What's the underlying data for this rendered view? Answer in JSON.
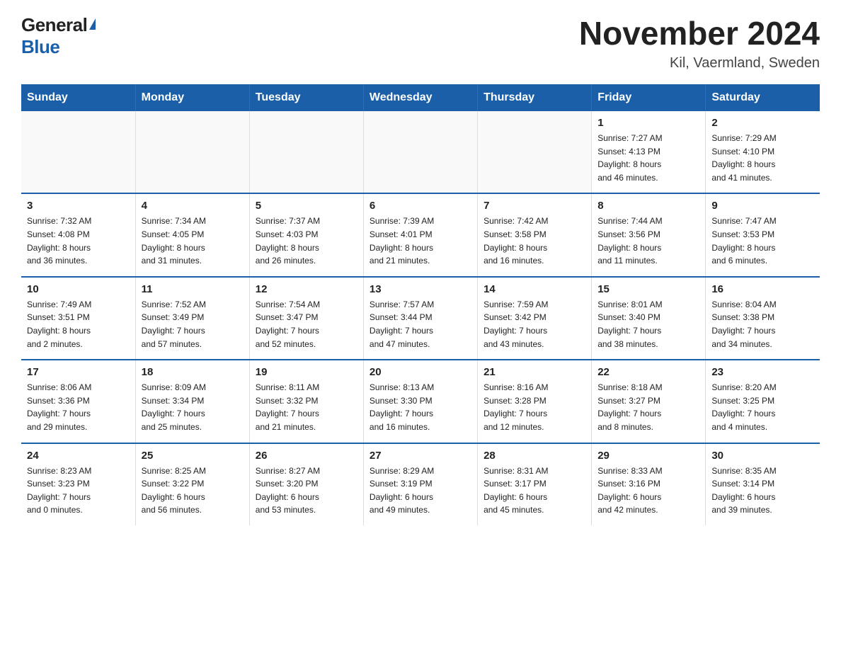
{
  "header": {
    "logo_general": "General",
    "logo_blue": "Blue",
    "month_title": "November 2024",
    "location": "Kil, Vaermland, Sweden"
  },
  "days_of_week": [
    "Sunday",
    "Monday",
    "Tuesday",
    "Wednesday",
    "Thursday",
    "Friday",
    "Saturday"
  ],
  "weeks": [
    {
      "days": [
        {
          "num": "",
          "info": "",
          "empty": true
        },
        {
          "num": "",
          "info": "",
          "empty": true
        },
        {
          "num": "",
          "info": "",
          "empty": true
        },
        {
          "num": "",
          "info": "",
          "empty": true
        },
        {
          "num": "",
          "info": "",
          "empty": true
        },
        {
          "num": "1",
          "info": "Sunrise: 7:27 AM\nSunset: 4:13 PM\nDaylight: 8 hours\nand 46 minutes.",
          "empty": false
        },
        {
          "num": "2",
          "info": "Sunrise: 7:29 AM\nSunset: 4:10 PM\nDaylight: 8 hours\nand 41 minutes.",
          "empty": false
        }
      ]
    },
    {
      "days": [
        {
          "num": "3",
          "info": "Sunrise: 7:32 AM\nSunset: 4:08 PM\nDaylight: 8 hours\nand 36 minutes.",
          "empty": false
        },
        {
          "num": "4",
          "info": "Sunrise: 7:34 AM\nSunset: 4:05 PM\nDaylight: 8 hours\nand 31 minutes.",
          "empty": false
        },
        {
          "num": "5",
          "info": "Sunrise: 7:37 AM\nSunset: 4:03 PM\nDaylight: 8 hours\nand 26 minutes.",
          "empty": false
        },
        {
          "num": "6",
          "info": "Sunrise: 7:39 AM\nSunset: 4:01 PM\nDaylight: 8 hours\nand 21 minutes.",
          "empty": false
        },
        {
          "num": "7",
          "info": "Sunrise: 7:42 AM\nSunset: 3:58 PM\nDaylight: 8 hours\nand 16 minutes.",
          "empty": false
        },
        {
          "num": "8",
          "info": "Sunrise: 7:44 AM\nSunset: 3:56 PM\nDaylight: 8 hours\nand 11 minutes.",
          "empty": false
        },
        {
          "num": "9",
          "info": "Sunrise: 7:47 AM\nSunset: 3:53 PM\nDaylight: 8 hours\nand 6 minutes.",
          "empty": false
        }
      ]
    },
    {
      "days": [
        {
          "num": "10",
          "info": "Sunrise: 7:49 AM\nSunset: 3:51 PM\nDaylight: 8 hours\nand 2 minutes.",
          "empty": false
        },
        {
          "num": "11",
          "info": "Sunrise: 7:52 AM\nSunset: 3:49 PM\nDaylight: 7 hours\nand 57 minutes.",
          "empty": false
        },
        {
          "num": "12",
          "info": "Sunrise: 7:54 AM\nSunset: 3:47 PM\nDaylight: 7 hours\nand 52 minutes.",
          "empty": false
        },
        {
          "num": "13",
          "info": "Sunrise: 7:57 AM\nSunset: 3:44 PM\nDaylight: 7 hours\nand 47 minutes.",
          "empty": false
        },
        {
          "num": "14",
          "info": "Sunrise: 7:59 AM\nSunset: 3:42 PM\nDaylight: 7 hours\nand 43 minutes.",
          "empty": false
        },
        {
          "num": "15",
          "info": "Sunrise: 8:01 AM\nSunset: 3:40 PM\nDaylight: 7 hours\nand 38 minutes.",
          "empty": false
        },
        {
          "num": "16",
          "info": "Sunrise: 8:04 AM\nSunset: 3:38 PM\nDaylight: 7 hours\nand 34 minutes.",
          "empty": false
        }
      ]
    },
    {
      "days": [
        {
          "num": "17",
          "info": "Sunrise: 8:06 AM\nSunset: 3:36 PM\nDaylight: 7 hours\nand 29 minutes.",
          "empty": false
        },
        {
          "num": "18",
          "info": "Sunrise: 8:09 AM\nSunset: 3:34 PM\nDaylight: 7 hours\nand 25 minutes.",
          "empty": false
        },
        {
          "num": "19",
          "info": "Sunrise: 8:11 AM\nSunset: 3:32 PM\nDaylight: 7 hours\nand 21 minutes.",
          "empty": false
        },
        {
          "num": "20",
          "info": "Sunrise: 8:13 AM\nSunset: 3:30 PM\nDaylight: 7 hours\nand 16 minutes.",
          "empty": false
        },
        {
          "num": "21",
          "info": "Sunrise: 8:16 AM\nSunset: 3:28 PM\nDaylight: 7 hours\nand 12 minutes.",
          "empty": false
        },
        {
          "num": "22",
          "info": "Sunrise: 8:18 AM\nSunset: 3:27 PM\nDaylight: 7 hours\nand 8 minutes.",
          "empty": false
        },
        {
          "num": "23",
          "info": "Sunrise: 8:20 AM\nSunset: 3:25 PM\nDaylight: 7 hours\nand 4 minutes.",
          "empty": false
        }
      ]
    },
    {
      "days": [
        {
          "num": "24",
          "info": "Sunrise: 8:23 AM\nSunset: 3:23 PM\nDaylight: 7 hours\nand 0 minutes.",
          "empty": false
        },
        {
          "num": "25",
          "info": "Sunrise: 8:25 AM\nSunset: 3:22 PM\nDaylight: 6 hours\nand 56 minutes.",
          "empty": false
        },
        {
          "num": "26",
          "info": "Sunrise: 8:27 AM\nSunset: 3:20 PM\nDaylight: 6 hours\nand 53 minutes.",
          "empty": false
        },
        {
          "num": "27",
          "info": "Sunrise: 8:29 AM\nSunset: 3:19 PM\nDaylight: 6 hours\nand 49 minutes.",
          "empty": false
        },
        {
          "num": "28",
          "info": "Sunrise: 8:31 AM\nSunset: 3:17 PM\nDaylight: 6 hours\nand 45 minutes.",
          "empty": false
        },
        {
          "num": "29",
          "info": "Sunrise: 8:33 AM\nSunset: 3:16 PM\nDaylight: 6 hours\nand 42 minutes.",
          "empty": false
        },
        {
          "num": "30",
          "info": "Sunrise: 8:35 AM\nSunset: 3:14 PM\nDaylight: 6 hours\nand 39 minutes.",
          "empty": false
        }
      ]
    }
  ]
}
